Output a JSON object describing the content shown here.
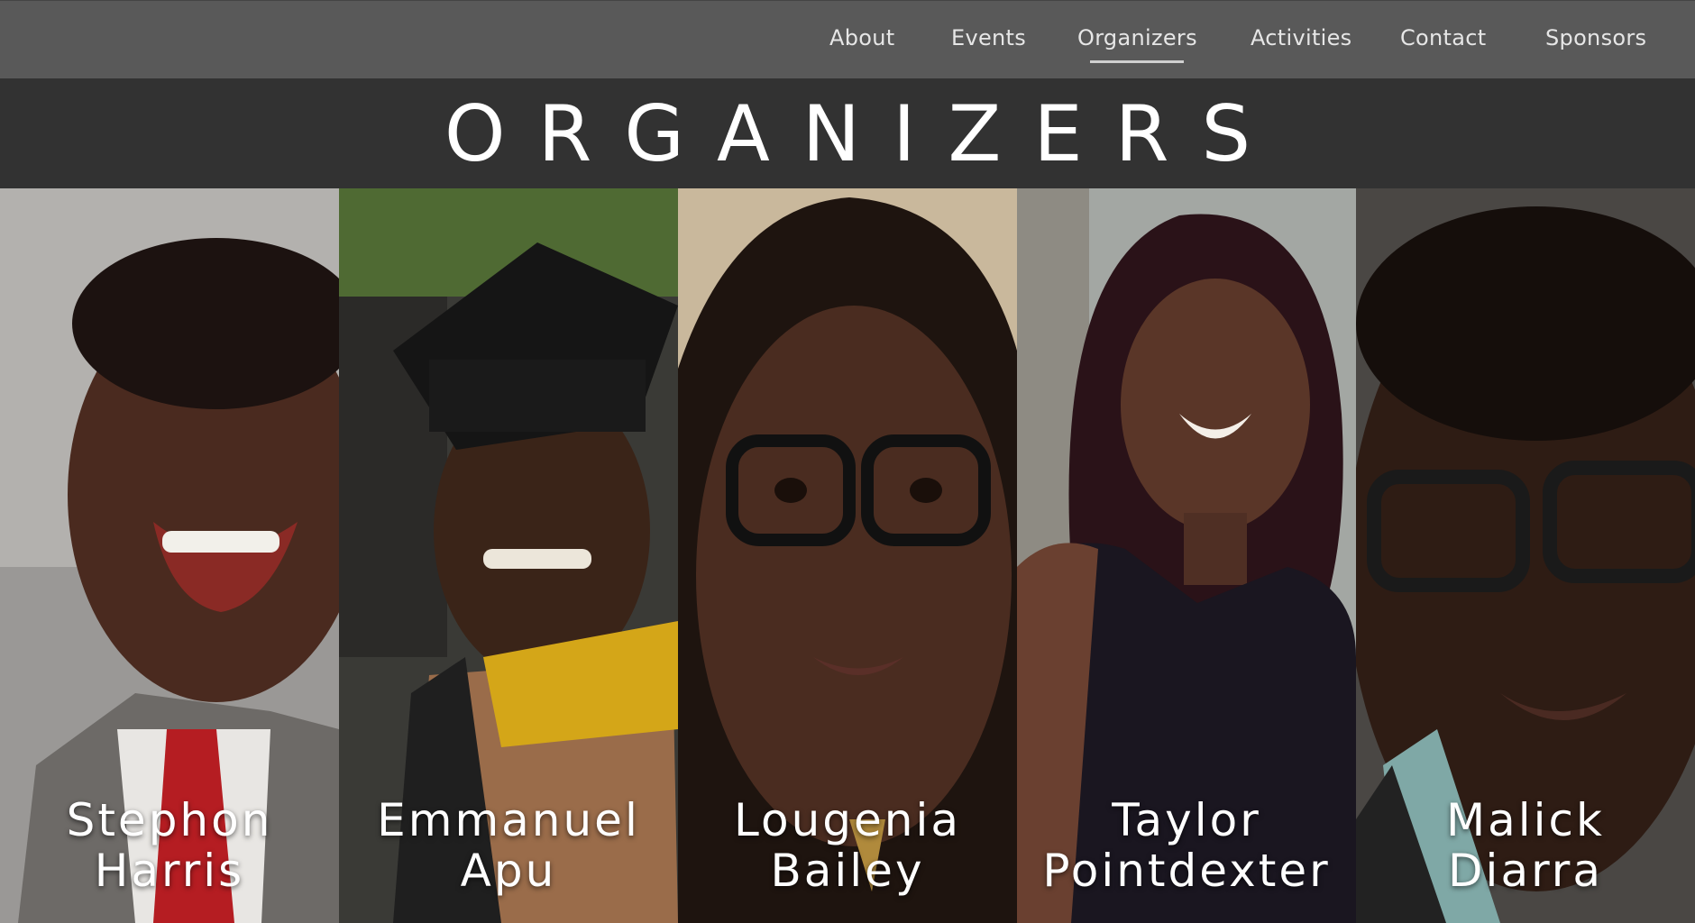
{
  "nav": {
    "items": [
      {
        "label": "About"
      },
      {
        "label": "Events"
      },
      {
        "label": "Organizers"
      },
      {
        "label": "Activities"
      },
      {
        "label": "Contact"
      },
      {
        "label": "Sponsors"
      }
    ],
    "active": "Organizers"
  },
  "header": {
    "title": "ORGANIZERS"
  },
  "organizers": [
    {
      "first": "Stephon",
      "last": "Harris"
    },
    {
      "first": "Emmanuel",
      "last": "Apu"
    },
    {
      "first": "Lougenia",
      "last": "Bailey"
    },
    {
      "first": "Taylor",
      "last": "Pointdexter"
    },
    {
      "first": "Malick",
      "last": "Diarra"
    }
  ],
  "colors": {
    "nav_bg": "#595959",
    "title_bg": "#323232",
    "text": "#ffffff"
  }
}
